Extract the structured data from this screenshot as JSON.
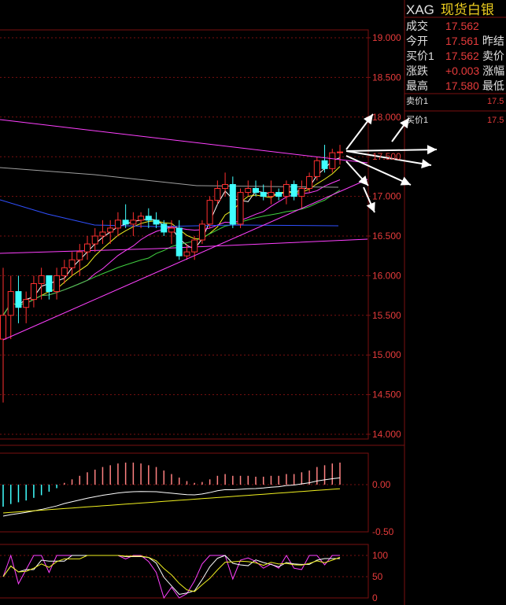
{
  "quote": {
    "symbol": "XAG",
    "name": "现货白银",
    "rows": [
      {
        "label": "成交",
        "value": "17.562",
        "label2": ""
      },
      {
        "label": "今开",
        "value": "17.561",
        "label2": "昨结"
      },
      {
        "label": "买价1",
        "value": "17.562",
        "label2": "卖价"
      },
      {
        "label": "涨跌",
        "value": "+0.003",
        "label2": "涨幅"
      },
      {
        "label": "最高",
        "value": "17.580",
        "label2": "最低"
      }
    ],
    "orderbook": [
      {
        "label": "卖价1",
        "value": "17.5"
      },
      {
        "label": "买价1",
        "value": "17.5"
      }
    ]
  },
  "colors": {
    "up": "#ff3030",
    "down": "#40ffff",
    "grid": "#7a1010",
    "axis_text": "#e63b3b",
    "ma_white": "#ffffff",
    "ma_yellow": "#f0f020",
    "ma_magenta": "#ff40ff",
    "ma_green": "#40d040",
    "ma_blue": "#3050ff",
    "ma_gray": "#a0a0a0"
  },
  "chart_data": [
    {
      "type": "candlestick",
      "title": "",
      "y_ticks": [
        "19.000",
        "18.500",
        "18.000",
        "17.500",
        "17.000",
        "16.500",
        "16.000",
        "15.500",
        "15.000",
        "14.500",
        "14.000"
      ],
      "ylim": [
        14.0,
        19.0
      ],
      "candles": [
        [
          15.2,
          16.1,
          14.4,
          15.5
        ],
        [
          15.5,
          16.0,
          15.2,
          15.8
        ],
        [
          15.8,
          16.0,
          15.4,
          15.6
        ],
        [
          15.6,
          15.8,
          15.4,
          15.7
        ],
        [
          15.7,
          16.0,
          15.6,
          15.9
        ],
        [
          15.9,
          16.1,
          15.7,
          16.0
        ],
        [
          16.0,
          16.0,
          15.7,
          15.8
        ],
        [
          15.8,
          16.1,
          15.7,
          16.0
        ],
        [
          16.0,
          16.2,
          15.9,
          16.1
        ],
        [
          16.1,
          16.3,
          16.0,
          16.2
        ],
        [
          16.2,
          16.4,
          16.0,
          16.3
        ],
        [
          16.3,
          16.5,
          16.2,
          16.4
        ],
        [
          16.4,
          16.6,
          16.3,
          16.5
        ],
        [
          16.5,
          16.7,
          16.4,
          16.55
        ],
        [
          16.55,
          16.7,
          16.4,
          16.6
        ],
        [
          16.6,
          16.8,
          16.5,
          16.7
        ],
        [
          16.7,
          16.9,
          16.6,
          16.65
        ],
        [
          16.65,
          16.8,
          16.5,
          16.7
        ],
        [
          16.7,
          16.8,
          16.6,
          16.75
        ],
        [
          16.75,
          16.85,
          16.6,
          16.7
        ],
        [
          16.7,
          16.8,
          16.6,
          16.65
        ],
        [
          16.65,
          16.7,
          16.5,
          16.55
        ],
        [
          16.55,
          16.7,
          16.4,
          16.6
        ],
        [
          16.6,
          16.7,
          16.2,
          16.25
        ],
        [
          16.25,
          16.4,
          16.2,
          16.3
        ],
        [
          16.3,
          16.5,
          16.2,
          16.45
        ],
        [
          16.45,
          16.7,
          16.4,
          16.65
        ],
        [
          16.65,
          17.0,
          16.6,
          16.95
        ],
        [
          16.95,
          17.2,
          16.9,
          17.1
        ],
        [
          17.1,
          17.3,
          17.0,
          17.15
        ],
        [
          17.15,
          17.25,
          16.6,
          16.65
        ],
        [
          16.65,
          17.1,
          16.6,
          17.05
        ],
        [
          17.05,
          17.2,
          17.0,
          17.1
        ],
        [
          17.1,
          17.2,
          17.0,
          17.05
        ],
        [
          17.05,
          17.15,
          16.95,
          17.0
        ],
        [
          17.0,
          17.2,
          16.9,
          17.05
        ],
        [
          17.05,
          17.1,
          16.95,
          17.0
        ],
        [
          17.0,
          17.2,
          16.9,
          17.15
        ],
        [
          17.15,
          17.2,
          16.95,
          17.0
        ],
        [
          17.0,
          17.2,
          16.85,
          17.1
        ],
        [
          17.1,
          17.3,
          17.05,
          17.25
        ],
        [
          17.25,
          17.5,
          17.2,
          17.45
        ],
        [
          17.45,
          17.65,
          17.3,
          17.35
        ],
        [
          17.35,
          17.6,
          17.3,
          17.55
        ],
        [
          17.55,
          17.65,
          17.4,
          17.56
        ]
      ],
      "indicator": "MACD",
      "macd_ticks": [
        "0.00",
        "-0.50"
      ],
      "macd_hist": [
        -0.25,
        -0.22,
        -0.2,
        -0.18,
        -0.15,
        -0.12,
        -0.08,
        -0.04,
        0.02,
        0.06,
        0.1,
        0.14,
        0.17,
        0.2,
        0.22,
        0.24,
        0.25,
        0.25,
        0.24,
        0.22,
        0.2,
        0.16,
        0.12,
        0.08,
        0.04,
        0.02,
        0.03,
        0.06,
        0.1,
        0.12,
        0.1,
        0.1,
        0.1,
        0.09,
        0.09,
        0.1,
        0.1,
        0.12,
        0.12,
        0.14,
        0.16,
        0.2,
        0.22,
        0.24,
        0.25
      ],
      "oscillator_ticks": [
        "100",
        "50",
        "0"
      ]
    }
  ]
}
